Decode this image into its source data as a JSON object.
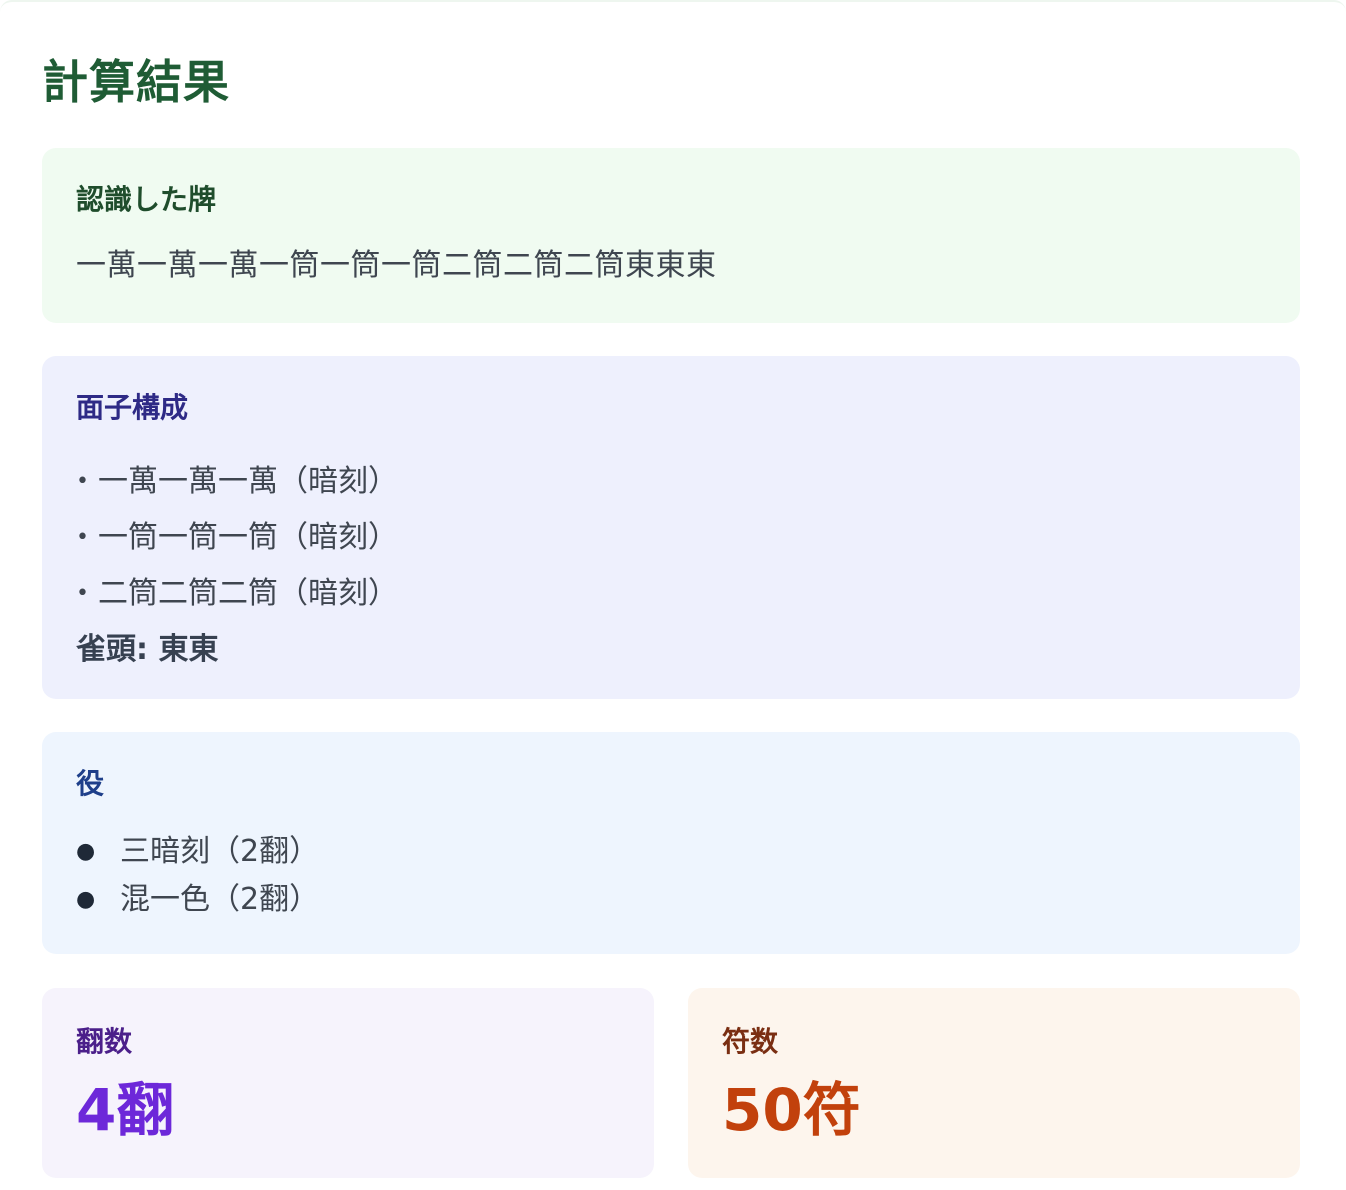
{
  "page": {
    "title": "計算結果"
  },
  "recognized": {
    "heading": "認識した牌",
    "tiles": "一萬一萬一萬一筒一筒一筒二筒二筒二筒東東東"
  },
  "melds": {
    "heading": "面子構成",
    "items": [
      {
        "bullet": "•",
        "text": "一萬一萬一萬（暗刻）"
      },
      {
        "bullet": "•",
        "text": "一筒一筒一筒（暗刻）"
      },
      {
        "bullet": "•",
        "text": "二筒二筒二筒（暗刻）"
      }
    ],
    "pair": "雀頭: 東東"
  },
  "yaku": {
    "heading": "役",
    "items": [
      {
        "text": "三暗刻（2翻）"
      },
      {
        "text": "混一色（2翻）"
      }
    ]
  },
  "han": {
    "label": "翻数",
    "value": "4翻"
  },
  "fu": {
    "label": "符数",
    "value": "50符"
  },
  "colors": {
    "title": "#1f5c35",
    "tiles_bg": "#f0fbf1",
    "melds_bg": "#eef0fd",
    "yaku_bg": "#eef5fe",
    "han_bg": "#f6f3fc",
    "fu_bg": "#fdf5ed",
    "han_value": "#6d28d9",
    "fu_value": "#c2410c"
  }
}
